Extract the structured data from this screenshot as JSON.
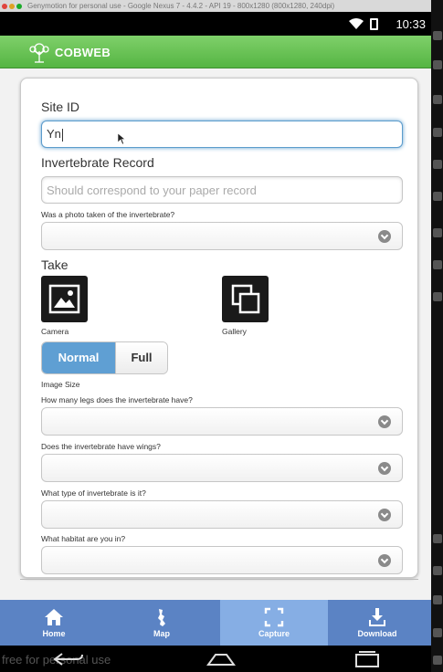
{
  "window": {
    "title": "Genymotion for personal use - Google Nexus 7 - 4.4.2 - API 19 - 800x1280 (800x1280, 240dpi)"
  },
  "status_bar": {
    "time": "10:33"
  },
  "app": {
    "title": "COBWEB"
  },
  "form": {
    "site_id": {
      "label": "Site ID",
      "value": "Yn"
    },
    "invertebrate_record": {
      "label": "Invertebrate Record",
      "placeholder": "Should correspond to your paper record"
    },
    "photo_question": {
      "label": "Was a photo taken of the invertebrate?",
      "value": ""
    },
    "take": {
      "label": "Take",
      "camera_label": "Camera",
      "gallery_label": "Gallery"
    },
    "image_size": {
      "options": [
        "Normal",
        "Full"
      ],
      "selected": "Normal",
      "label": "Image Size"
    },
    "legs_question": {
      "label": "How many legs does the invertebrate have?",
      "value": ""
    },
    "wings_question": {
      "label": "Does the invertebrate have wings?",
      "value": ""
    },
    "type_question": {
      "label": "What type of invertebrate is it?",
      "value": ""
    },
    "habitat_question": {
      "label": "What habitat are you in?",
      "value": ""
    }
  },
  "tabs": [
    {
      "label": "Home",
      "icon": "home-icon",
      "active": false
    },
    {
      "label": "Map",
      "icon": "map-icon",
      "active": false
    },
    {
      "label": "Capture",
      "icon": "capture-icon",
      "active": true
    },
    {
      "label": "Download",
      "icon": "download-icon",
      "active": false
    }
  ],
  "nav": {
    "watermark": "free for personal use"
  },
  "colors": {
    "header_green": "#55b543",
    "tab_blue": "#5b83c4",
    "tab_active": "#86aee4",
    "toggle_active": "#5f9fd3"
  }
}
